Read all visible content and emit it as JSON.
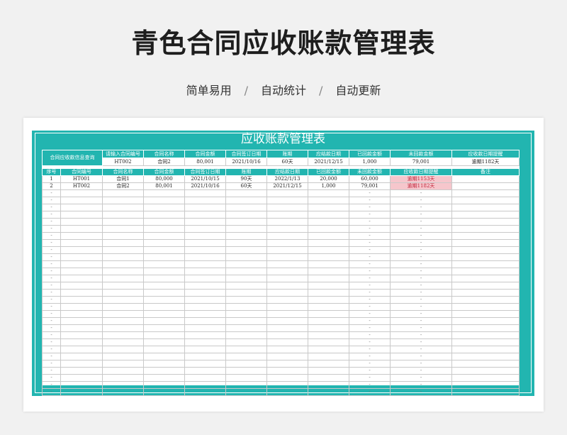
{
  "page": {
    "title": "青色合同应收账款管理表",
    "subtitle": [
      "简单易用",
      "自动统计",
      "自动更新"
    ],
    "separator": "/"
  },
  "sheet": {
    "banner": "应收账款管理表",
    "query": {
      "label": "合同应收款信息查询",
      "headers": [
        "请输入合同编号",
        "合同名称",
        "合同金额",
        "合同签订日期",
        "账期",
        "应结款日期",
        "已回款金额",
        "未回款金额",
        "应收款日期提醒"
      ],
      "values": [
        "HT002",
        "合同2",
        "80,001",
        "2021/10/16",
        "60天",
        "2021/12/15",
        "1,000",
        "79,001",
        "逾期1182天"
      ]
    },
    "columns": [
      "序号",
      "合同编号",
      "合同名称",
      "合同金额",
      "合同签订日期",
      "账期",
      "应结款日期",
      "已回款金额",
      "未回款金额",
      "应收款日期提醒",
      "备注"
    ],
    "rows": [
      [
        "1",
        "HT001",
        "合同1",
        "80,000",
        "2021/10/15",
        "90天",
        "2022/1/13",
        "20,000",
        "60,000",
        "逾期1153天",
        ""
      ],
      [
        "2",
        "HT002",
        "合同2",
        "80,001",
        "2021/10/16",
        "60天",
        "2021/12/15",
        "1,000",
        "79,001",
        "逾期1182天",
        ""
      ]
    ],
    "empty_cell_mark": "-",
    "accent_color": "#22b5b0",
    "overdue_bg": "#f6c6cc"
  }
}
